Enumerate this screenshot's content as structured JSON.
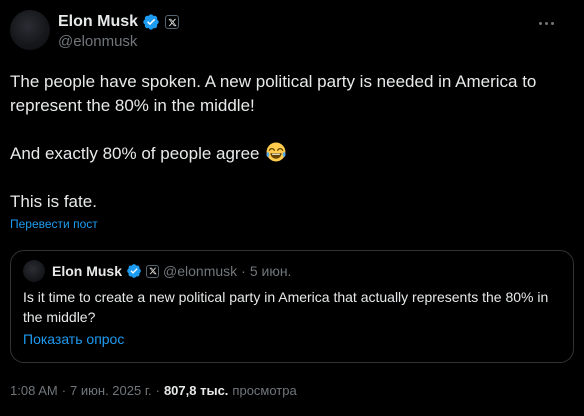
{
  "author": {
    "display_name": "Elon Musk",
    "handle": "@elonmusk"
  },
  "post": {
    "line1": "The people have spoken. A new political party is needed in America to represent the 80% in the middle!",
    "line2": "And exactly 80% of people agree",
    "line2_emoji": "face-with-tears-of-joy-icon",
    "line3": "This is fate.",
    "translate_label": "Перевести пост"
  },
  "quote": {
    "display_name": "Elon Musk",
    "handle": "@elonmusk",
    "dot": "·",
    "date": "5 июн.",
    "text": "Is it time to create a new political party in America that actually represents the 80% in the middle?",
    "poll_link": "Показать опрос"
  },
  "meta": {
    "time": "1:08 AM",
    "sep1": "·",
    "date": "7 июн. 2025 г.",
    "sep2": "·",
    "views_count": "807,8 тыс.",
    "views_label": "просмотра"
  },
  "colors": {
    "background": "#000000",
    "text": "#e7e9ea",
    "secondary": "#71767b",
    "accent": "#1d9bf0",
    "border": "#2f3336"
  }
}
